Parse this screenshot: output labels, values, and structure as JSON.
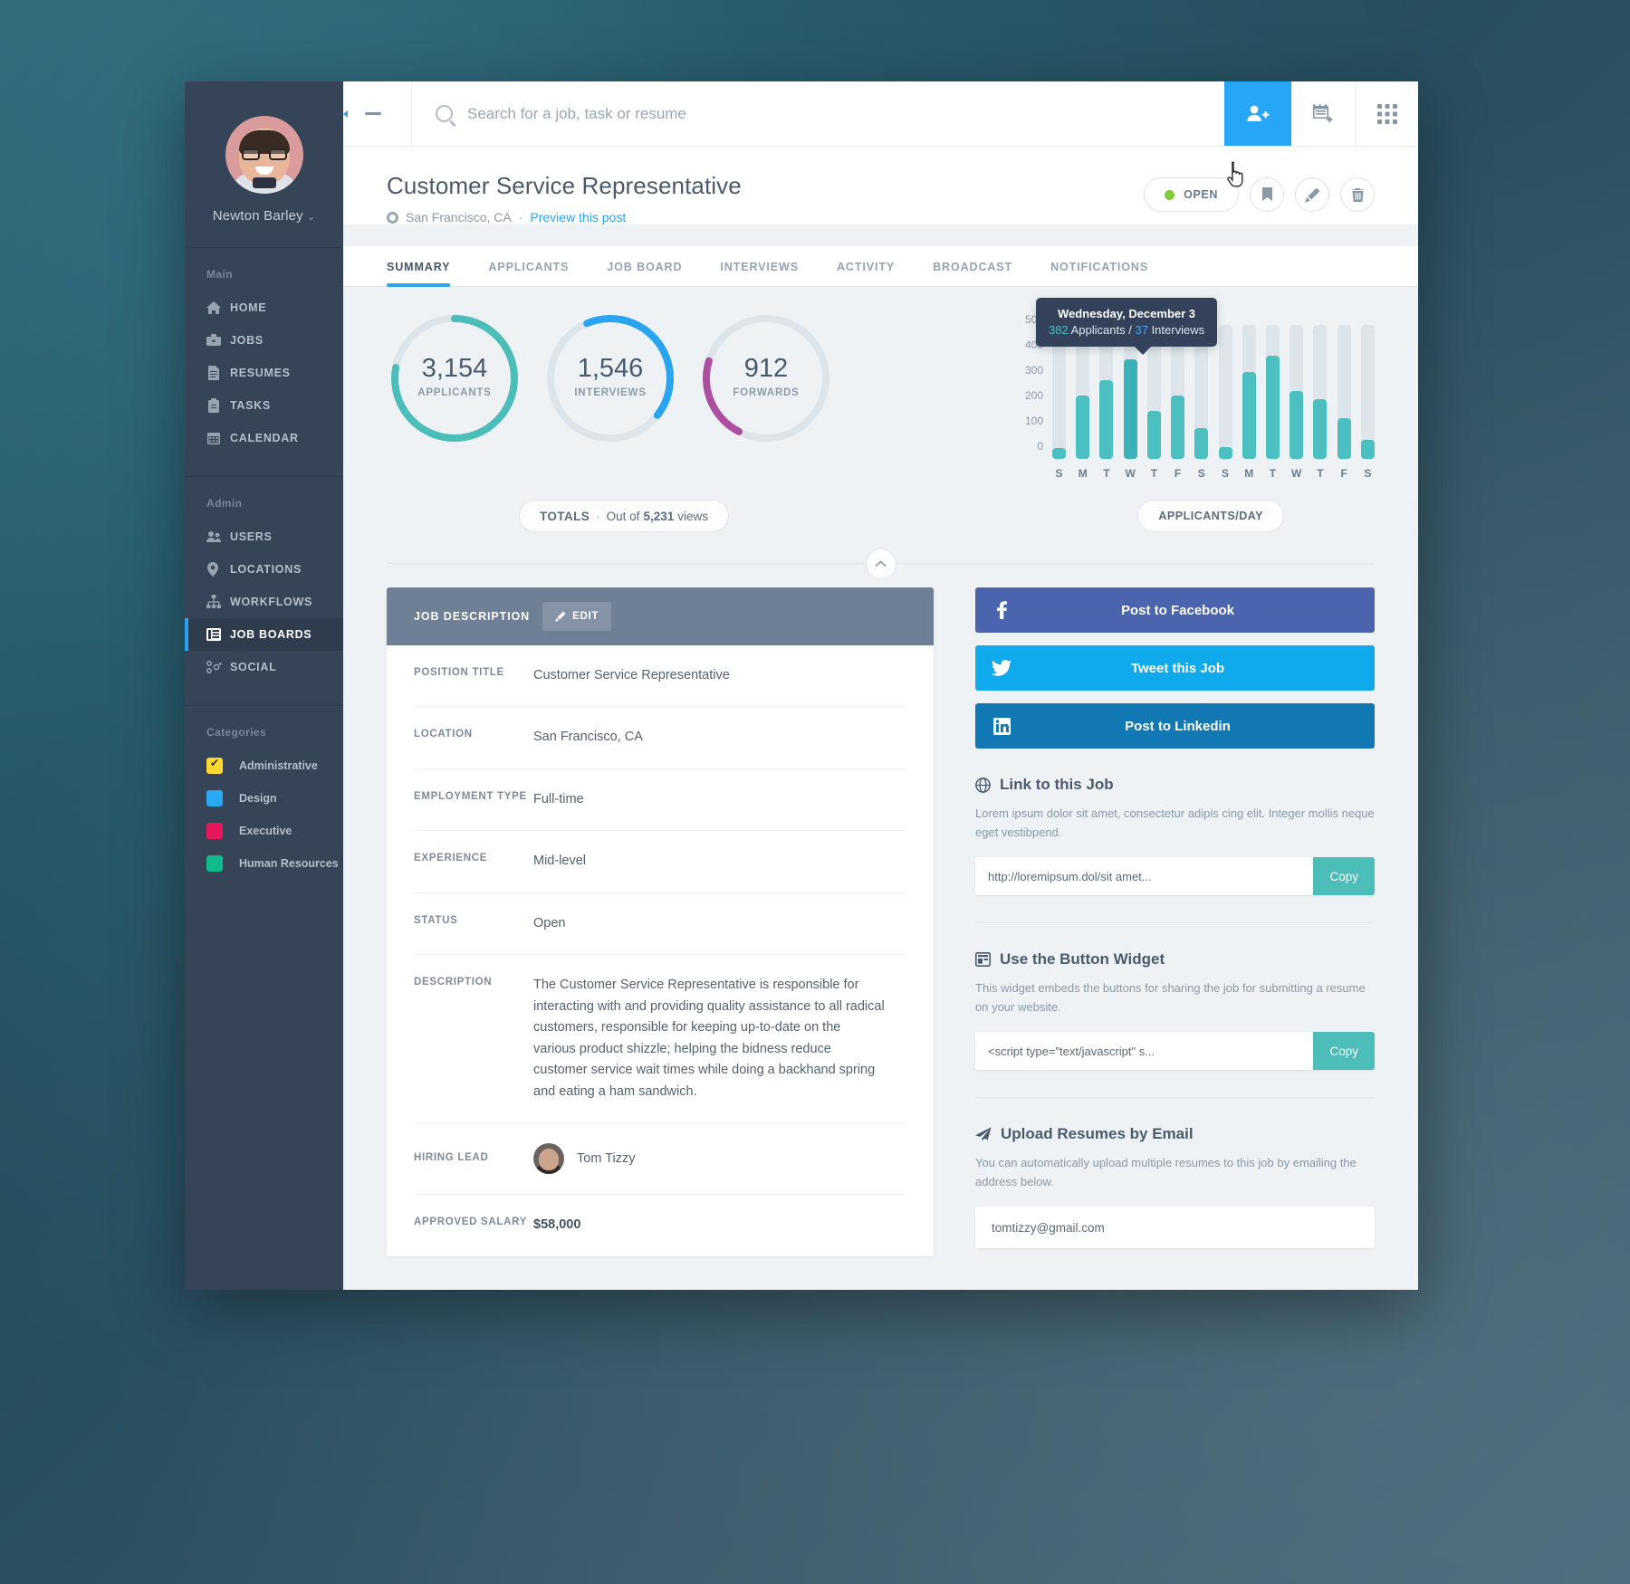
{
  "sidebar": {
    "profile": {
      "name": "Newton Barley",
      "chevron": "⌄",
      "avatar_alt": "user-avatar"
    },
    "groups": [
      {
        "title": "Main",
        "items": [
          {
            "label": "HOME",
            "icon": "home-icon",
            "active": false
          },
          {
            "label": "JOBS",
            "icon": "briefcase-icon",
            "active": false
          },
          {
            "label": "RESUMES",
            "icon": "document-icon",
            "active": false
          },
          {
            "label": "TASKS",
            "icon": "clipboard-icon",
            "active": false
          },
          {
            "label": "CALENDAR",
            "icon": "calendar-icon",
            "active": false
          }
        ]
      },
      {
        "title": "Admin",
        "items": [
          {
            "label": "USERS",
            "icon": "users-icon",
            "active": false
          },
          {
            "label": "LOCATIONS",
            "icon": "map-pin-icon",
            "active": false
          },
          {
            "label": "WORKFLOWS",
            "icon": "sitemap-icon",
            "active": false
          },
          {
            "label": "JOB BOARDS",
            "icon": "board-icon",
            "active": true
          },
          {
            "label": "SOCIAL",
            "icon": "share-icon",
            "active": false
          }
        ]
      }
    ],
    "categories_title": "Categories",
    "categories": [
      {
        "label": "Administrative",
        "color": "#fdd835",
        "checked": true
      },
      {
        "label": "Design",
        "color": "#29a9f2",
        "checked": false
      },
      {
        "label": "Executive",
        "color": "#e8175d",
        "checked": false
      },
      {
        "label": "Human Resources",
        "color": "#0fba8b",
        "checked": false
      }
    ]
  },
  "topbar": {
    "menu_icon": "hamburger-collapse-icon",
    "search_placeholder": "Search for a job, task or resume",
    "search_value": "",
    "actions": [
      {
        "name": "add-user-button",
        "icon": "person-plus-icon",
        "primary": true
      },
      {
        "name": "new-post-button",
        "icon": "note-plus-icon",
        "primary": false
      },
      {
        "name": "apps-grid-button",
        "icon": "grid-icon",
        "primary": false
      }
    ]
  },
  "page": {
    "title": "Customer Service Representative",
    "location": "San Francisco, CA",
    "separator": "·",
    "preview_link": "Preview this post",
    "status": "OPEN",
    "status_color": "#7fc93b",
    "actions": [
      {
        "name": "bookmark-button",
        "icon": "bookmark-icon"
      },
      {
        "name": "edit-button",
        "icon": "pencil-icon"
      },
      {
        "name": "delete-button",
        "icon": "trash-icon"
      }
    ]
  },
  "tabs": [
    {
      "label": "SUMMARY",
      "active": true
    },
    {
      "label": "APPLICANTS",
      "active": false
    },
    {
      "label": "JOB BOARD",
      "active": false
    },
    {
      "label": "INTERVIEWS",
      "active": false
    },
    {
      "label": "ACTIVITY",
      "active": false
    },
    {
      "label": "BROADCAST",
      "active": false
    },
    {
      "label": "NOTIFICATIONS",
      "active": false
    }
  ],
  "stats": {
    "donuts": [
      {
        "value": "3,154",
        "label": "APPLICANTS",
        "percent": 78,
        "color": "#4cbdb8"
      },
      {
        "value": "1,546",
        "label": "INTERVIEWS",
        "percent": 42,
        "color": "#2aa3f0"
      },
      {
        "value": "912",
        "label": "FORWARDS",
        "percent": 22,
        "color": "#ad4fa0"
      }
    ],
    "totals_pill_label": "TOTALS",
    "totals_pill_sep": "·",
    "totals_pill_text_pre": "Out of",
    "totals_pill_views": "5,231",
    "totals_pill_text_post": "views",
    "per_day_pill": "APPLICANTS/DAY"
  },
  "chart_data": {
    "type": "bar",
    "title": "Applicants per day",
    "categories": [
      "S",
      "M",
      "T",
      "W",
      "T",
      "F",
      "S",
      "S",
      "M",
      "T",
      "W",
      "T",
      "F",
      "S"
    ],
    "values": [
      42,
      238,
      295,
      372,
      178,
      237,
      115,
      43,
      325,
      385,
      255,
      222,
      152,
      72
    ],
    "track_max": 500,
    "ylim": [
      0,
      500
    ],
    "yticks": [
      0,
      100,
      200,
      300,
      400,
      500
    ],
    "ylabel": "",
    "xlabel": "",
    "grid": false,
    "series": [
      {
        "name": "Applicants",
        "values": [
          42,
          238,
          295,
          372,
          178,
          237,
          115,
          43,
          325,
          385,
          255,
          222,
          152,
          72
        ]
      }
    ],
    "highlight_index": 3,
    "tooltip": {
      "date": "Wednesday, December 3",
      "applicants": "382",
      "applicants_label": "Applicants",
      "divider": "/",
      "interviews": "37",
      "interviews_label": "Interviews"
    }
  },
  "job_description": {
    "header": "JOB DESCRIPTION",
    "edit_label": "EDIT",
    "rows": [
      {
        "key": "POSITION TITLE",
        "value": "Customer Service Representative"
      },
      {
        "key": "LOCATION",
        "value": "San Francisco, CA"
      },
      {
        "key": "EMPLOYMENT TYPE",
        "value": "Full-time"
      },
      {
        "key": "EXPERIENCE",
        "value": "Mid-level"
      },
      {
        "key": "STATUS",
        "value": "Open"
      },
      {
        "key": "DESCRIPTION",
        "value": "The Customer Service Representative is responsible for interacting with and providing quality assistance to all radical customers, responsible for keeping up-to-date on the various product shizzle; helping the bidness reduce customer service wait times while doing a backhand spring and eating a ham sandwich."
      },
      {
        "key": "HIRING LEAD",
        "value": "Tom Tizzy"
      },
      {
        "key": "APPROVED SALARY",
        "value": "$58,000"
      }
    ]
  },
  "share": {
    "buttons": [
      {
        "label": "Post to Facebook",
        "icon": "facebook-icon",
        "color": "#4a64ad"
      },
      {
        "label": "Tweet this Job",
        "icon": "twitter-icon",
        "color": "#10aaec"
      },
      {
        "label": "Post to Linkedin",
        "icon": "linkedin-icon",
        "color": "#1278b3"
      }
    ],
    "link_section": {
      "title": "Link to this Job",
      "icon": "globe-icon",
      "description": "Lorem ipsum dolor sit amet, consectetur adipis cing elit. Integer mollis neque eget vestibpend.",
      "value": "http://loremipsum.dol/sit amet...",
      "copy_label": "Copy"
    },
    "widget_section": {
      "title": "Use the Button Widget",
      "icon": "widget-icon",
      "description": "This widget embeds the buttons for sharing the job for submitting a resume on your website.",
      "value": "<script type=\"text/javascript\" s...",
      "copy_label": "Copy"
    },
    "email_section": {
      "title": "Upload Resumes by Email",
      "icon": "paper-plane-icon",
      "description": "You can automatically upload multiple resumes to this job by emailing the address below.",
      "value": "tomtizzy@gmail.com"
    }
  }
}
